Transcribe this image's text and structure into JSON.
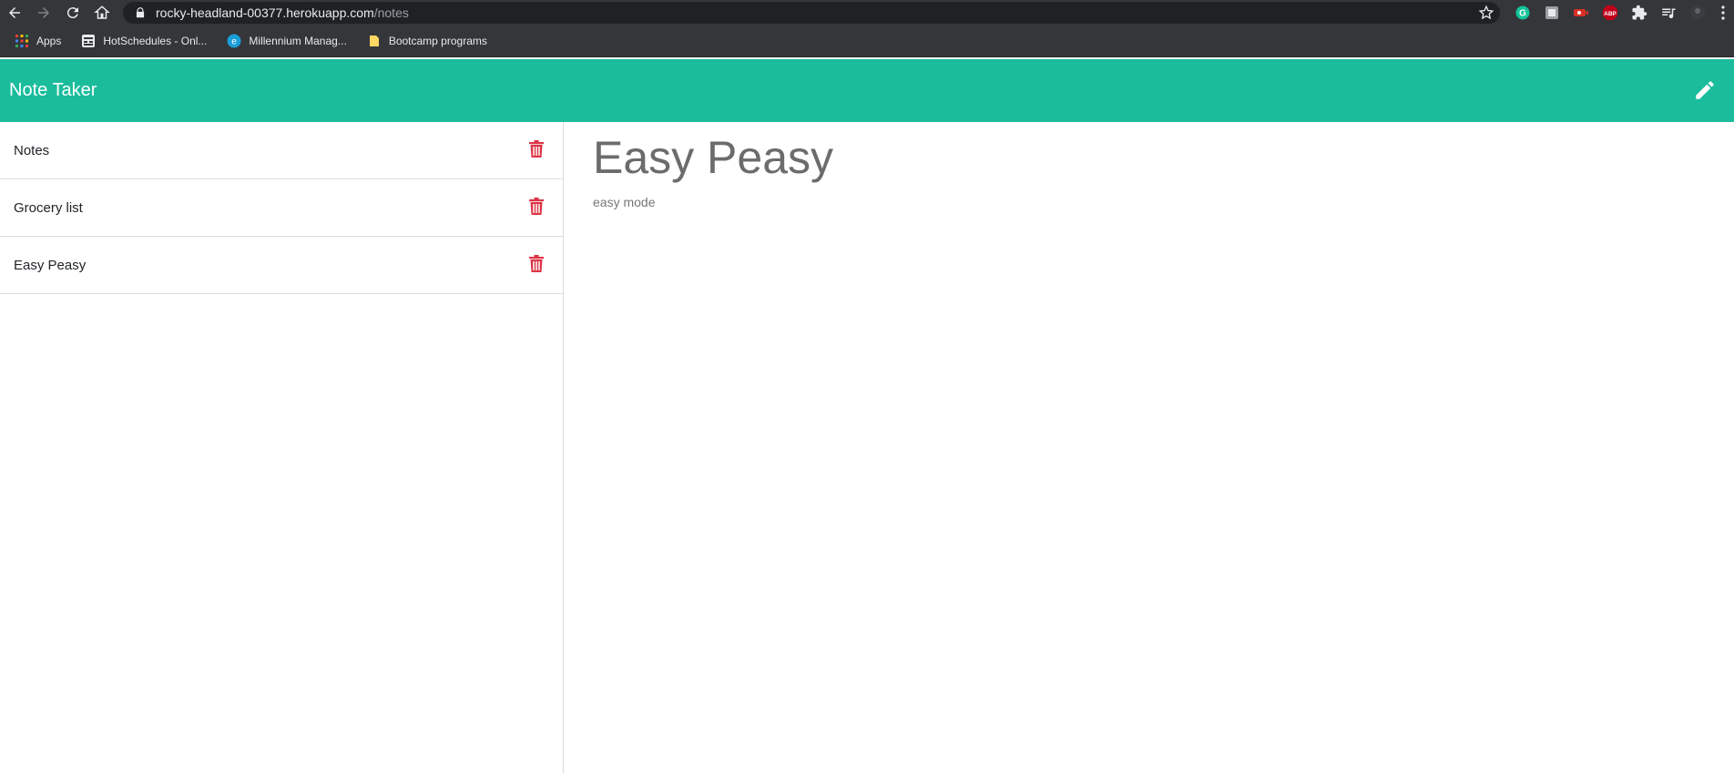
{
  "browser": {
    "url_host": "rocky-headland-00377.herokuapp.com",
    "url_path": "/notes",
    "bookmarks": [
      {
        "label": "Apps",
        "icon": "apps-grid-icon"
      },
      {
        "label": "HotSchedules - Onl...",
        "icon": "hotschedules-icon"
      },
      {
        "label": "Millennium Manag...",
        "icon": "millennium-icon"
      },
      {
        "label": "Bootcamp programs",
        "icon": "folder-icon"
      }
    ],
    "extensions": [
      "grammarly-icon",
      "extension-icon",
      "video-extension-icon",
      "adblock-plus-icon",
      "puzzle-icon",
      "media-control-icon",
      "profile-icon",
      "menu-dots-icon"
    ],
    "colors": {
      "chrome_bg": "#35363a",
      "omnibox_bg": "#202124",
      "abp_red": "#c0001a",
      "grammarly_green": "#15c39a"
    }
  },
  "app": {
    "brand": "Note Taker",
    "new_note_icon": "pencil-icon",
    "accent_color": "#1abc9c",
    "delete_color": "#dc3545",
    "notes": [
      {
        "title": "Notes"
      },
      {
        "title": "Grocery list"
      },
      {
        "title": "Easy Peasy"
      }
    ],
    "active_note": {
      "title": "Easy Peasy",
      "text": "easy mode"
    }
  }
}
